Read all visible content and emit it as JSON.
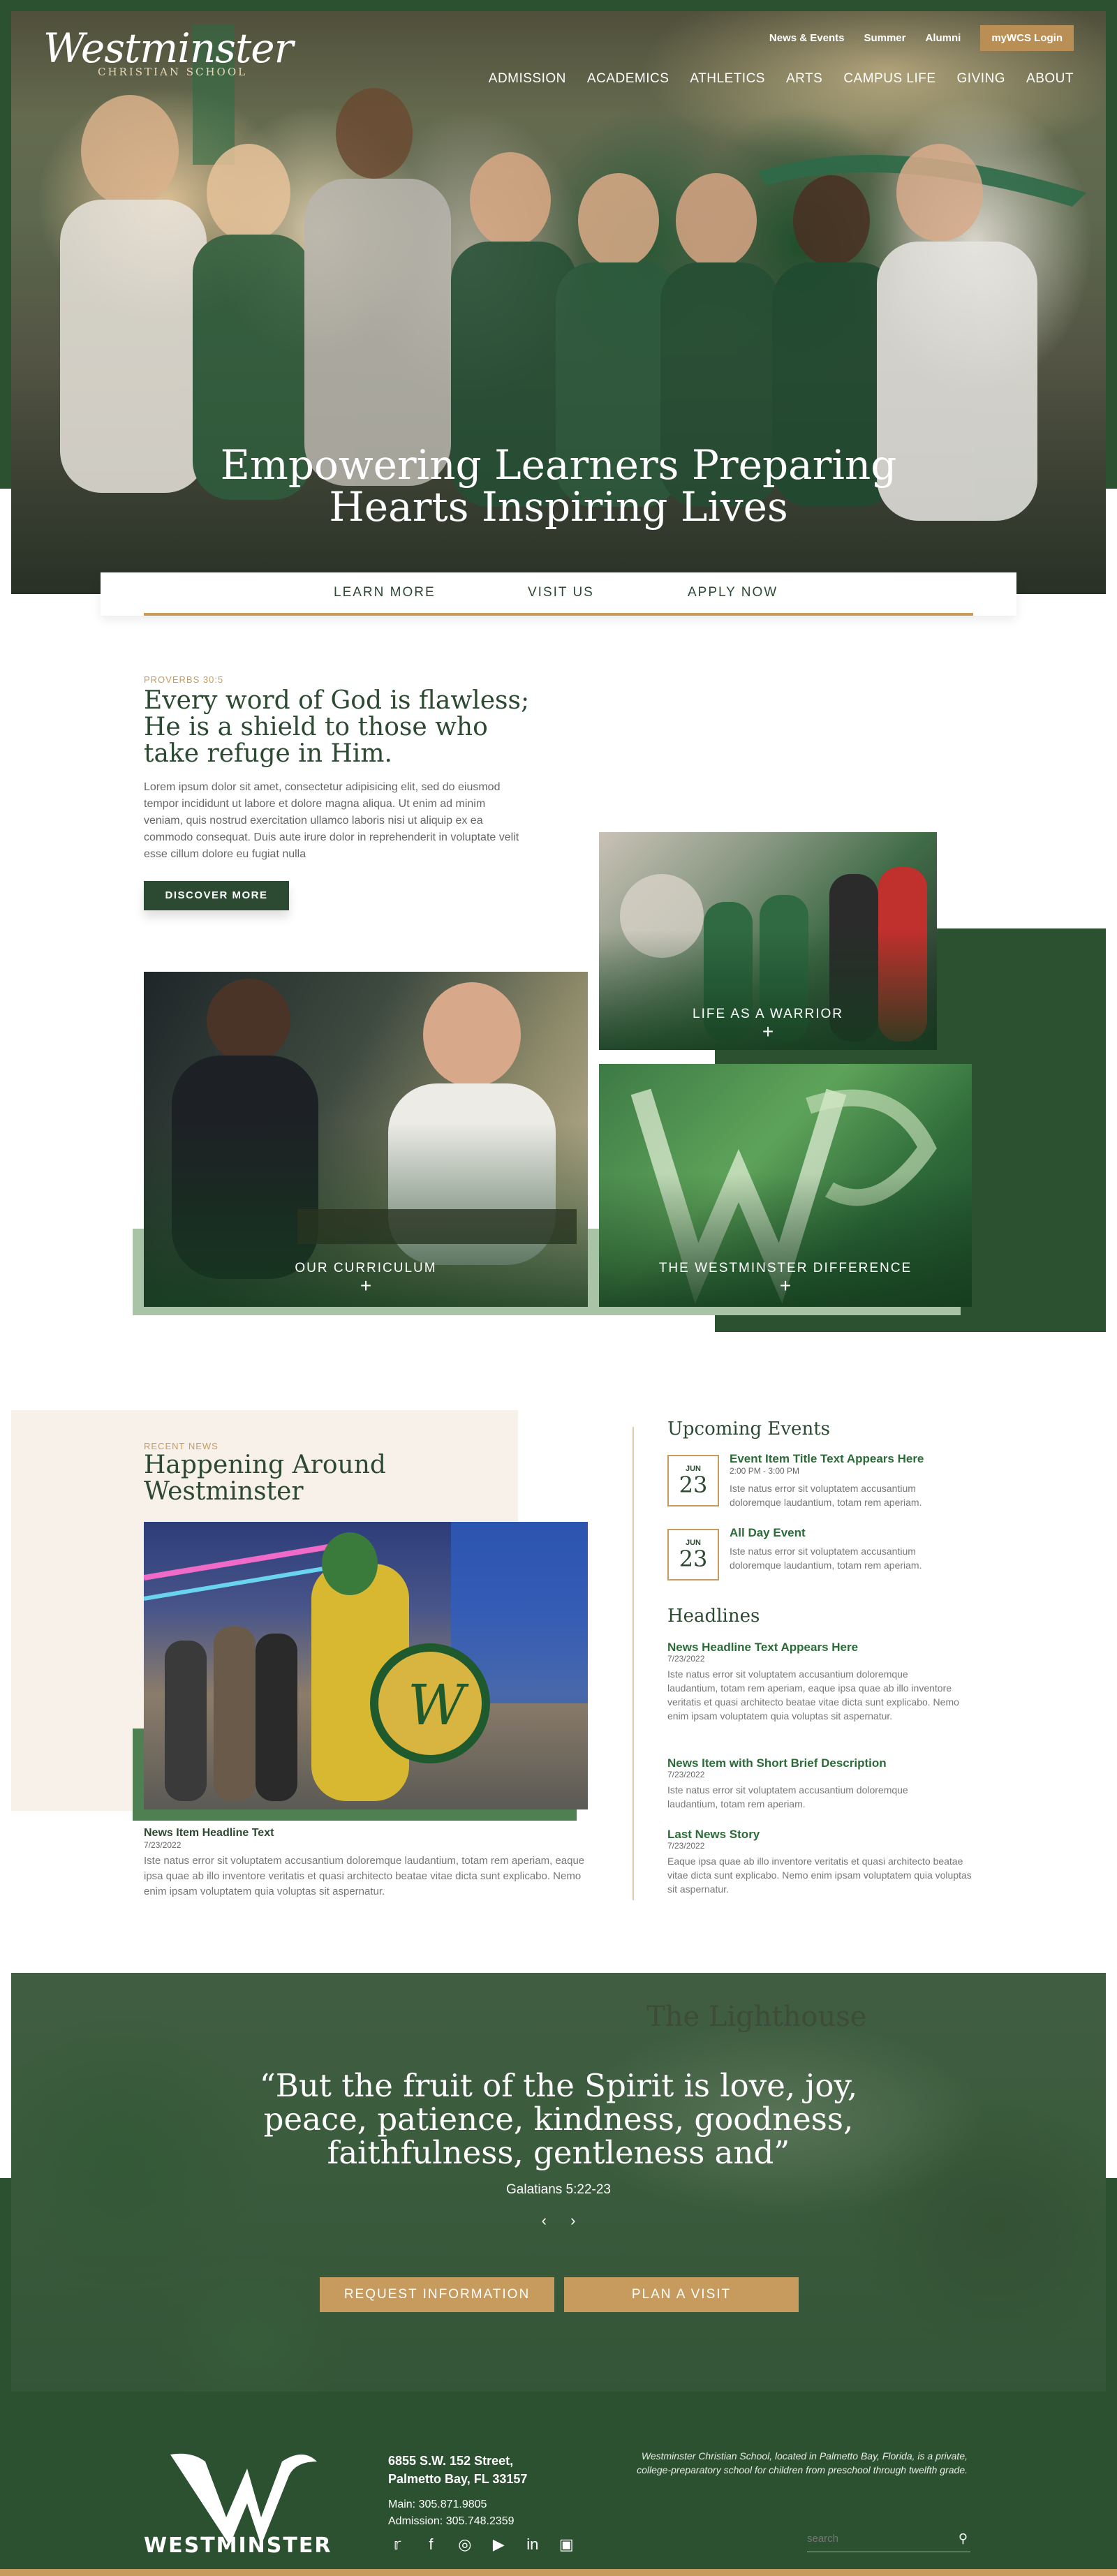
{
  "header": {
    "logo_word": "Westminster",
    "logo_sub": "CHRISTIAN SCHOOL",
    "utility_nav": [
      "News & Events",
      "Summer",
      "Alumni"
    ],
    "mywcs_label": "myWCS Login",
    "main_nav": [
      "ADMISSION",
      "ACADEMICS",
      "ATHLETICS",
      "ARTS",
      "CAMPUS LIFE",
      "GIVING",
      "ABOUT"
    ]
  },
  "hero": {
    "title_line1": "Empowering Learners Preparing",
    "title_line2": "Hearts Inspiring Lives"
  },
  "cta_bar": {
    "learn_more": "LEARN MORE",
    "visit_us": "VISIT US",
    "apply_now": "APPLY NOW"
  },
  "proverb": {
    "eyebrow": "PROVERBS 30:5",
    "line1": "Every word of God is flawless;",
    "line2": "He is a shield to those who",
    "line3": "take refuge in Him.",
    "body": "Lorem ipsum dolor sit amet, consectetur adipisicing elit, sed do eiusmod tempor incididunt ut labore et dolore magna aliqua. Ut enim ad minim veniam, quis nostrud exercitation ullamco laboris nisi ut aliquip ex ea commodo consequat. Duis aute irure dolor in reprehenderit in voluptate velit esse cillum dolore eu fugiat nulla",
    "button": "DISCOVER MORE"
  },
  "tiles": {
    "life": "LIFE AS A WARRIOR",
    "curriculum": "OUR CURRICULUM",
    "difference": "THE WESTMINSTER DIFFERENCE",
    "plus": "+"
  },
  "news": {
    "eyebrow": "RECENT NEWS",
    "heading_line1": "Happening Around",
    "heading_line2": "Westminster",
    "feature_title": "News Item Headline Text",
    "feature_date": "7/23/2022",
    "feature_body": "Iste natus error sit voluptatem accusantium doloremque laudantium, totam rem aperiam, eaque ipsa quae ab illo inventore veritatis et quasi architecto beatae vitae dicta sunt explicabo. Nemo enim ipsam voluptatem quia voluptas sit aspernatur."
  },
  "events": {
    "heading": "Upcoming Events",
    "items": [
      {
        "month": "JUN",
        "day": "23",
        "title": "Event Item Title Text Appears Here",
        "time": "2:00 PM - 3:00 PM",
        "body": "Iste natus error sit voluptatem accusantium doloremque laudantium, totam rem aperiam."
      },
      {
        "month": "JUN",
        "day": "23",
        "title": "All Day Event",
        "time": "",
        "body": "Iste natus error sit voluptatem accusantium doloremque laudantium, totam rem aperiam."
      }
    ]
  },
  "headlines": {
    "heading": "Headlines",
    "items": [
      {
        "title": "News Headline Text Appears Here",
        "date": "7/23/2022",
        "body": "Iste natus error sit voluptatem accusantium doloremque laudantium, totam rem aperiam, eaque ipsa quae ab illo inventore veritatis et quasi architecto beatae vitae dicta sunt explicabo. Nemo enim ipsam voluptatem quia voluptas sit aspernatur."
      },
      {
        "title": "News Item with Short Brief Description",
        "date": "7/23/2022",
        "body": "Iste natus error sit voluptatem accusantium doloremque laudantium, totam rem aperiam."
      },
      {
        "title": "Last News Story",
        "date": "7/23/2022",
        "body": "Eaque ipsa quae ab illo inventore veritatis et quasi architecto beatae vitae dicta sunt explicabo. Nemo enim ipsam voluptatem quia voluptas sit aspernatur."
      }
    ]
  },
  "testimonial": {
    "sign": "The Lighthouse",
    "quote_line1": "“But the fruit of the Spirit is love, joy,",
    "quote_line2": "peace, patience, kindness, goodness,",
    "quote_line3": "faithfulness, gentleness and”",
    "citation": "Galatians 5:22-23",
    "prev": "‹",
    "next": "›",
    "request_info": "REQUEST INFORMATION",
    "plan_visit": "PLAN A VISIT"
  },
  "footer": {
    "logo_word": "WESTMINSTER",
    "address_line1": "6855 S.W. 152 Street,",
    "address_line2": "Palmetto Bay, FL 33157",
    "main_phone": "Main: 305.871.9805",
    "admission_phone": "Admission: 305.748.2359",
    "blurb": "Westminster Christian School, located in Palmetto Bay, Florida, is a private, college-preparatory school for children from preschool through twelfth grade.",
    "search_placeholder": "search",
    "social": [
      "twitter-icon",
      "facebook-icon",
      "instagram-icon",
      "youtube-icon",
      "linkedin-icon",
      "photo-icon"
    ]
  },
  "colors": {
    "brand_green": "#2c5131",
    "accent_gold": "#c79a5e",
    "cream": "#f7f1ea"
  }
}
